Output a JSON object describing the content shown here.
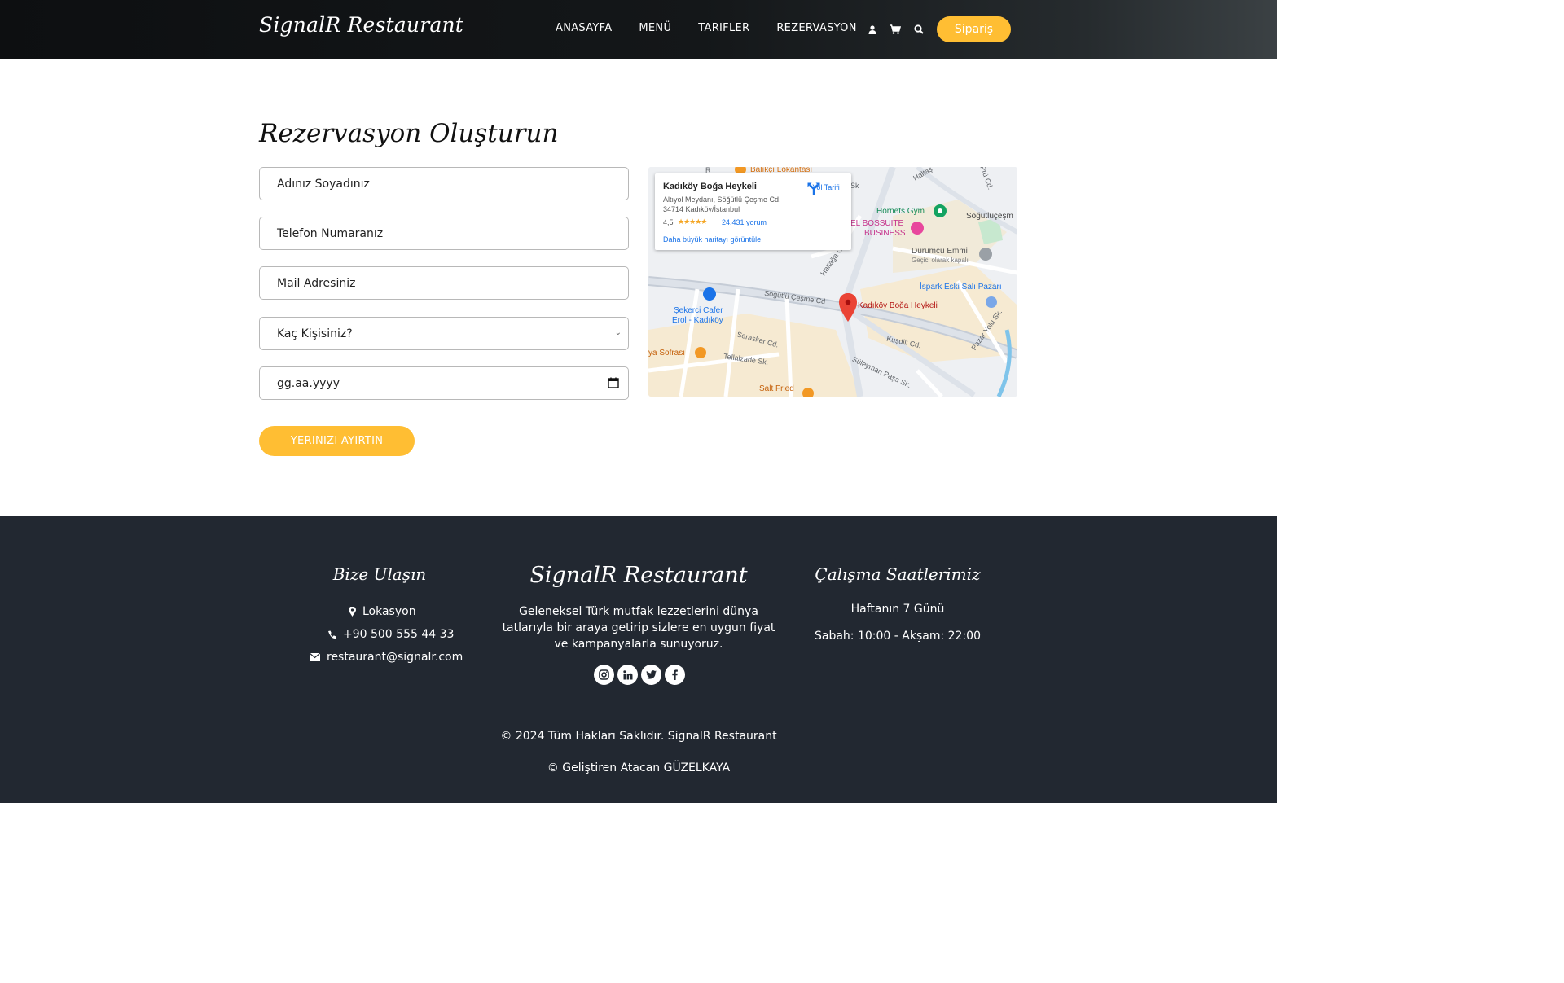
{
  "header": {
    "brand": "SignalR Restaurant",
    "nav": [
      "ANASAYFA",
      "MENÜ",
      "TARIFLER",
      "REZERVASYON"
    ],
    "icons": [
      "user-icon",
      "cart-icon",
      "search-icon"
    ],
    "order_button": "Sipariş"
  },
  "reservation": {
    "title": "Rezervasyon Oluşturun",
    "name_placeholder": "Adınız Soyadınız",
    "phone_placeholder": "Telefon Numaranız",
    "email_placeholder": "Mail Adresiniz",
    "guests_selected": "Kaç Kişisiniz?",
    "date_placeholder": "gg.aa.yyyy",
    "submit": "YERINIZI AYIRTIN"
  },
  "map": {
    "place_name": "Kadıköy Boğa Heykeli",
    "address_line1": "Altıyol Meydanı, Söğütlü Çeşme Cd,",
    "address_line2": "34714 Kadıköy/İstanbul",
    "rating": "4,5",
    "stars": "★★★★★",
    "reviews": "24.431 yorum",
    "larger_map": "Daha büyük haritayı görüntüle",
    "directions": "Yol Tarifi",
    "labels": {
      "balikci": "Balıkçı Lokantası",
      "haltag": "Haltaş",
      "hornets": "Hornets Gym",
      "sogutlu": "Söğütlüçeşm",
      "bossuite": "EL BOSSUITE",
      "business": "BUSINESS",
      "durumcu": "Dürümcü Emmi",
      "gecici": "Geçici olarak kapalı",
      "ispark": "İspark Eski Salı Pazarı",
      "sekerci1": "Şekerci Cafer",
      "sekerci2": "Erol - Kadıköy",
      "pin_label": "Kadıköy Boğa Heykeli",
      "sofrasi": "ya Sofrası",
      "saltfried": "Salt Fried",
      "street_sogutlu": "Söğütlü Çeşme Cd",
      "street_serasker": "Serasker Cd.",
      "street_tellalzade": "Tellalzade Sk.",
      "street_kusdili": "Kuşdili Cd.",
      "street_suleyman": "Süleyman Paşa Sk.",
      "street_pazaryolu": "Pazar Yolu Sk.",
      "street_haltaga": "Haltağa Cd.",
      "street_sk": "Sk",
      "street_r": "R",
      "street_pru": "Prü Cd."
    }
  },
  "footer": {
    "contact_title": "Bize Ulaşın",
    "location": "Lokasyon",
    "phone": "+90 500 555 44 33",
    "email": "restaurant@signalr.com",
    "brand": "SignalR Restaurant",
    "description_1": "Geleneksel Türk mutfak lezzetlerini dünya",
    "description_2": "tatlarıyla bir araya getirip sizlere en uygun fiyat",
    "description_3": "ve kampanyalarla sunuyoruz.",
    "hours_title": "Çalışma Saatlerimiz",
    "hours_days": "Haftanın 7 Günü",
    "hours_time": "Sabah: 10:00 - Akşam: 22:00",
    "social": [
      "instagram-icon",
      "linkedin-icon",
      "twitter-icon",
      "facebook-icon"
    ],
    "copyright": "© 2024 Tüm Hakları Saklıdır. SignalR Restaurant",
    "developer": "© Geliştiren Atacan GÜZELKAYA"
  }
}
